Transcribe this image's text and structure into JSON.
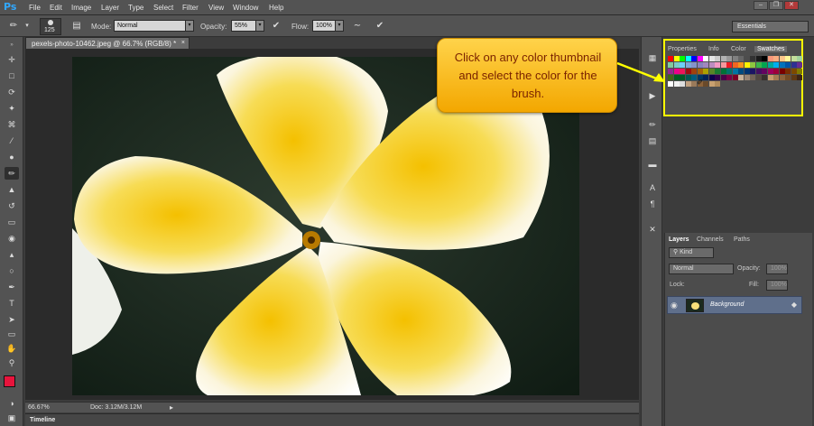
{
  "app": {
    "name": "Ps"
  },
  "menus": [
    "File",
    "Edit",
    "Image",
    "Layer",
    "Type",
    "Select",
    "Filter",
    "View",
    "Window",
    "Help"
  ],
  "options": {
    "brush_size": "125",
    "mode_label": "Mode:",
    "mode_value": "Normal",
    "opacity_label": "Opacity:",
    "opacity_value": "55%",
    "flow_label": "Flow:",
    "flow_value": "100%"
  },
  "workspace": "Essentials",
  "document": {
    "tab_title": "pexels-photo-10462.jpeg @ 66.7% (RGB/8) *",
    "zoom": "66.67%",
    "doc_info": "Doc: 3.12M/3.12M"
  },
  "timeline_label": "Timeline",
  "swatch_panel": {
    "tabs": [
      "Properties",
      "Info",
      "Color",
      "Swatches"
    ],
    "active_tab": "Swatches"
  },
  "layers_panel": {
    "tabs": [
      "Layers",
      "Channels",
      "Paths"
    ],
    "filter_kind": "Kind",
    "blend_mode": "Normal",
    "opacity_label": "Opacity:",
    "opacity_value": "100%",
    "lock_label": "Lock:",
    "fill_label": "Fill:",
    "fill_value": "100%",
    "layer_name": "Background"
  },
  "callout": {
    "text": "Click on any color thumbnail and select the color for the brush."
  },
  "colors": {
    "foreground": "#e8143c",
    "background": "#ffffff",
    "highlight": "#ffff00"
  }
}
